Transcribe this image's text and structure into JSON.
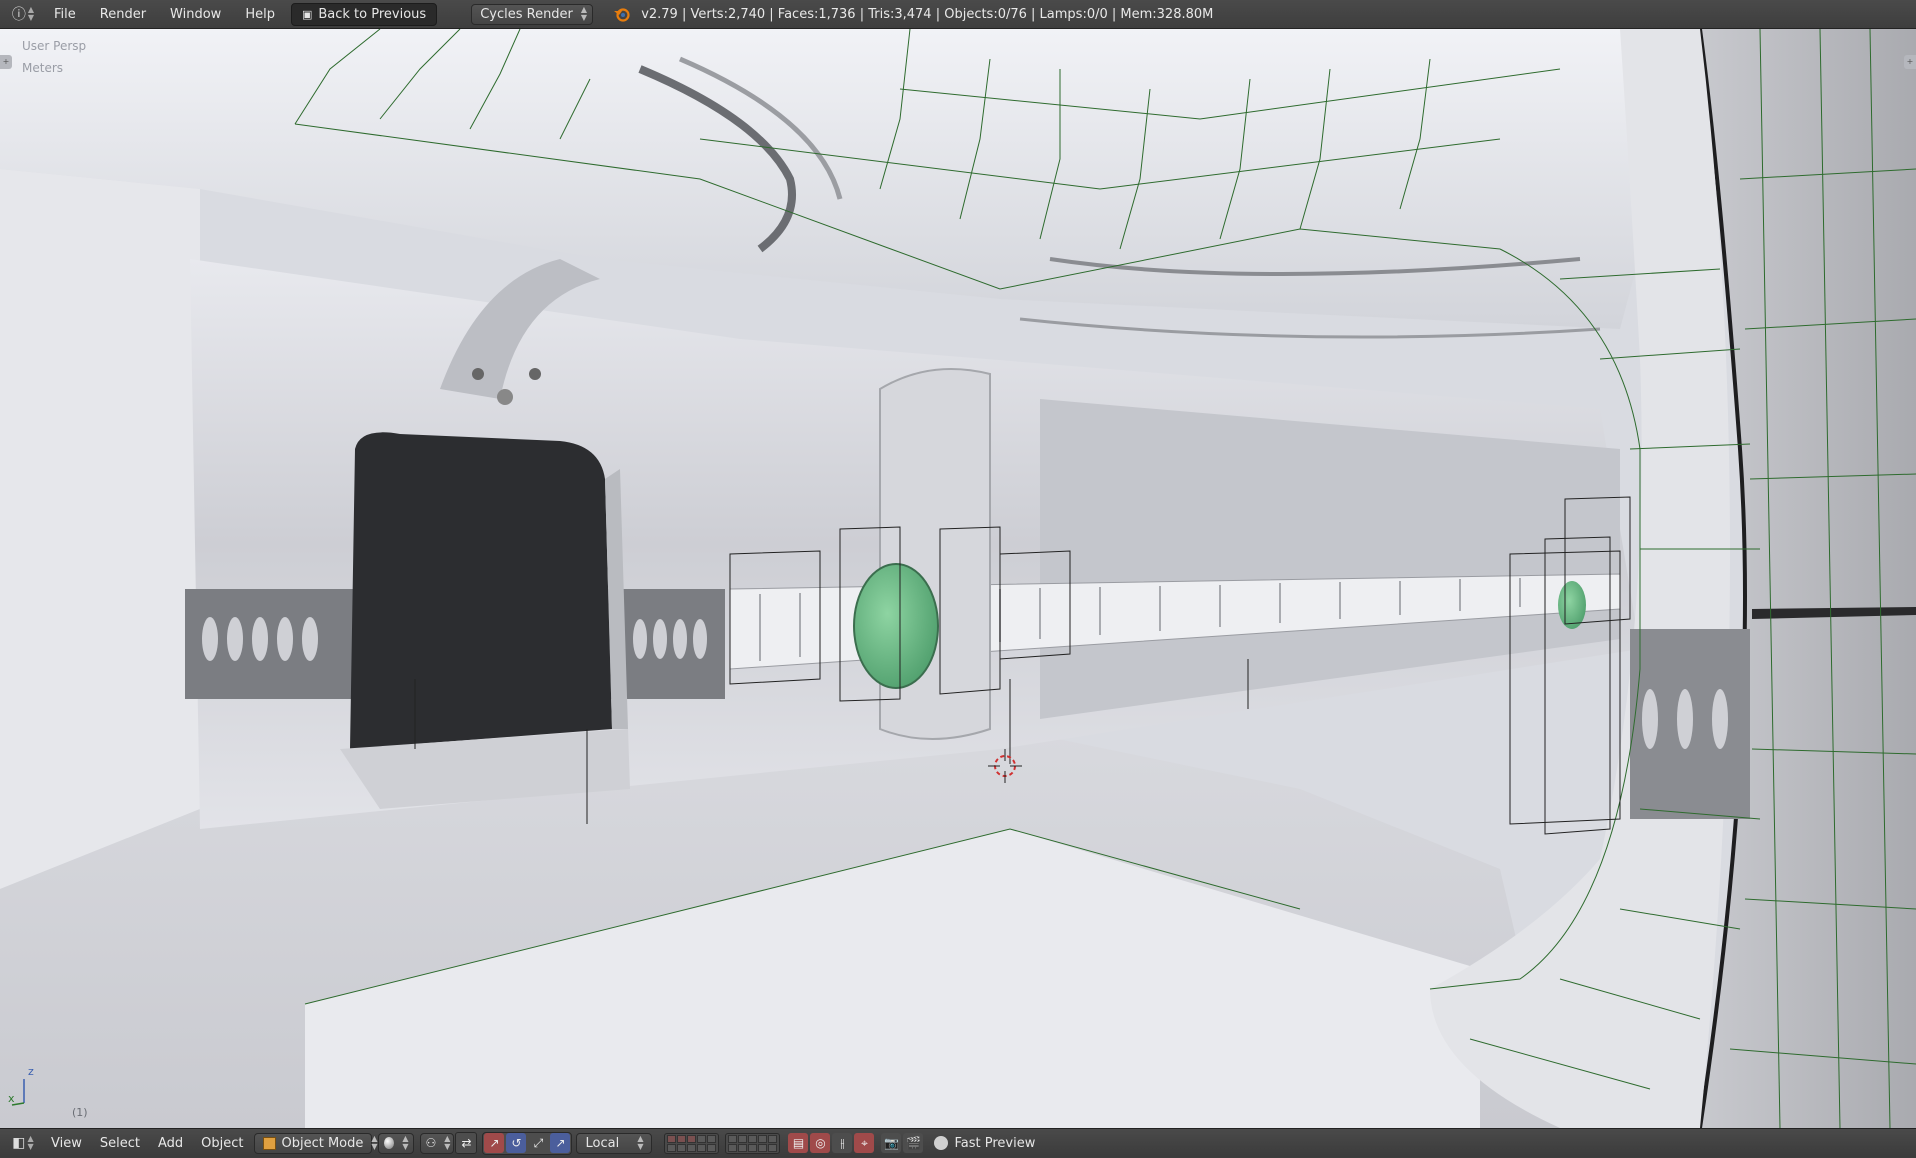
{
  "topbar": {
    "menus": [
      "File",
      "Render",
      "Window",
      "Help"
    ],
    "back_button": "Back to Previous",
    "render_engine": "Cycles Render",
    "stats": "v2.79 | Verts:2,740 | Faces:1,736 | Tris:3,474 | Objects:0/76 | Lamps:0/0 | Mem:328.80M"
  },
  "viewport": {
    "view_name": "User Persp",
    "units": "Meters",
    "frame": "(1)",
    "axis_z": "z",
    "axis_x": "x"
  },
  "bottombar": {
    "menus": [
      "View",
      "Select",
      "Add",
      "Object"
    ],
    "mode": "Object Mode",
    "pivot": "Local",
    "preview": "Fast Preview"
  },
  "colors": {
    "header_bg": "#3e3e3e",
    "wire": "#2e6b2e",
    "accent_green": "#5fae7a",
    "cursor_red": "#d03030"
  },
  "icons": {
    "info": "info-icon",
    "blender": "blender-logo-icon",
    "editor": "3d-view-icon",
    "cursor": "3d-cursor-icon"
  }
}
